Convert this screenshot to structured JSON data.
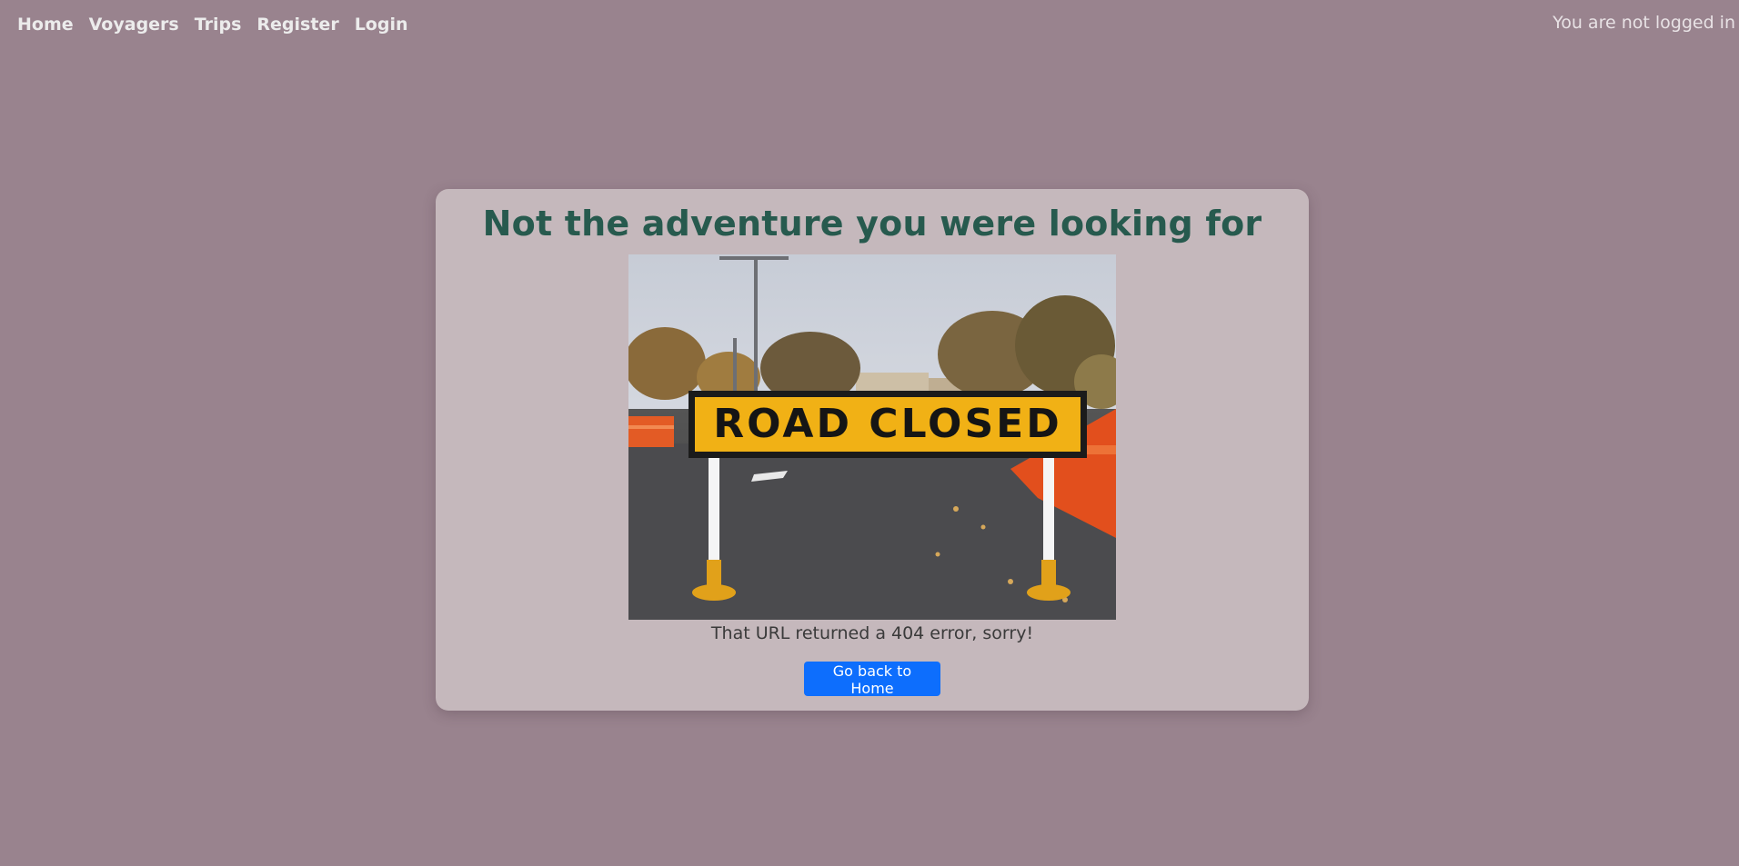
{
  "nav": {
    "links": [
      "Home",
      "Voyagers",
      "Trips",
      "Register",
      "Login"
    ],
    "status": "You are not logged in"
  },
  "main": {
    "title": "Not the adventure you were looking for",
    "image_sign_text": "ROAD CLOSED",
    "message": "That URL returned a 404 error, sorry!",
    "button_label": "Go back to Home"
  },
  "colors": {
    "background": "#99838e",
    "card": "#c5b8bc",
    "title": "#275a4e",
    "button": "#0d6efd",
    "sign": "#f1b115"
  }
}
